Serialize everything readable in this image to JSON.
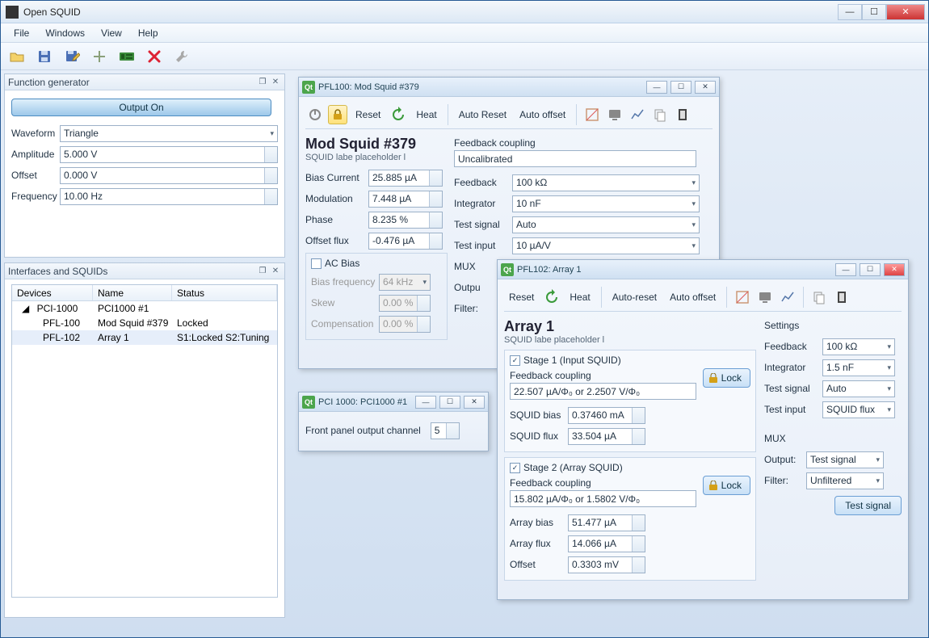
{
  "window": {
    "title": "Open SQUID"
  },
  "menubar": {
    "items": [
      "File",
      "Windows",
      "View",
      "Help"
    ]
  },
  "dock_fn": {
    "title": "Function generator",
    "output_btn": "Output On",
    "rows": {
      "waveform_label": "Waveform",
      "waveform_value": "Triangle",
      "amplitude_label": "Amplitude",
      "amplitude_value": "5.000 V",
      "offset_label": "Offset",
      "offset_value": "0.000 V",
      "frequency_label": "Frequency",
      "frequency_value": "10.00 Hz"
    }
  },
  "dock_ifc": {
    "title": "Interfaces and SQUIDs",
    "headers": {
      "dev": "Devices",
      "name": "Name",
      "status": "Status"
    },
    "rows": [
      {
        "dev": "PCI-1000",
        "name": "PCI1000 #1",
        "status": ""
      },
      {
        "dev": "PFL-100",
        "name": "Mod Squid #379",
        "status": "Locked"
      },
      {
        "dev": "PFL-102",
        "name": "Array 1",
        "status": "S1:Locked  S2:Tuning"
      }
    ]
  },
  "pfl100": {
    "title": "PFL100: Mod Squid #379",
    "toolbar": {
      "reset": "Reset",
      "heat": "Heat",
      "autoreset": "Auto Reset",
      "autooffset": "Auto offset"
    },
    "name": "Mod Squid #379",
    "subtitle": "SQUID labe placeholder l",
    "left": {
      "bias_current_l": "Bias Current",
      "bias_current_v": "25.885 µA",
      "modulation_l": "Modulation",
      "modulation_v": "7.448 µA",
      "phase_l": "Phase",
      "phase_v": "8.235 %",
      "offset_flux_l": "Offset flux",
      "offset_flux_v": "-0.476 µA",
      "ac_bias_l": "AC Bias",
      "bias_freq_l": "Bias frequency",
      "bias_freq_v": "64 kHz",
      "skew_l": "Skew",
      "skew_v": "0.00 %",
      "comp_l": "Compensation",
      "comp_v": "0.00 %"
    },
    "right": {
      "fc_l": "Feedback coupling",
      "fc_v": "Uncalibrated",
      "feedback_l": "Feedback",
      "feedback_v": "100 kΩ",
      "integrator_l": "Integrator",
      "integrator_v": "10 nF",
      "testsig_l": "Test signal",
      "testsig_v": "Auto",
      "testin_l": "Test input",
      "testin_v": "10 µA/V",
      "mux_l": "MUX",
      "output_l": "Outpu",
      "filter_l": "Filter:"
    }
  },
  "pci": {
    "title": "PCI 1000: PCI1000 #1",
    "channel_l": "Front panel output channel",
    "channel_v": "5"
  },
  "pfl102": {
    "title": "PFL102: Array 1",
    "toolbar": {
      "reset": "Reset",
      "heat": "Heat",
      "autoreset": "Auto-reset",
      "autooffset": "Auto offset"
    },
    "name": "Array 1",
    "subtitle": "SQUID labe placeholder l",
    "stage1": {
      "title": "Stage 1 (Input SQUID)",
      "fc_l": "Feedback coupling",
      "fc_v": "22.507 µA/Φ₀ or 2.2507 V/Φ₀",
      "bias_l": "SQUID bias",
      "bias_v": "0.37460 mA",
      "flux_l": "SQUID flux",
      "flux_v": "33.504 µA",
      "lock": "Lock"
    },
    "stage2": {
      "title": "Stage 2 (Array SQUID)",
      "fc_l": "Feedback coupling",
      "fc_v": "15.802 µA/Φ₀ or 1.5802 V/Φ₀",
      "abias_l": "Array bias",
      "abias_v": "51.477 µA",
      "aflux_l": "Array flux",
      "aflux_v": "14.066 µA",
      "offset_l": "Offset",
      "offset_v": "0.3303 mV",
      "lock": "Lock"
    },
    "settings": {
      "title": "Settings",
      "feedback_l": "Feedback",
      "feedback_v": "100 kΩ",
      "integrator_l": "Integrator",
      "integrator_v": "1.5 nF",
      "testsig_l": "Test signal",
      "testsig_v": "Auto",
      "testin_l": "Test input",
      "testin_v": "SQUID flux"
    },
    "mux": {
      "title": "MUX",
      "output_l": "Output:",
      "output_v": "Test signal",
      "filter_l": "Filter:",
      "filter_v": "Unfiltered",
      "testsig_btn": "Test signal"
    }
  }
}
